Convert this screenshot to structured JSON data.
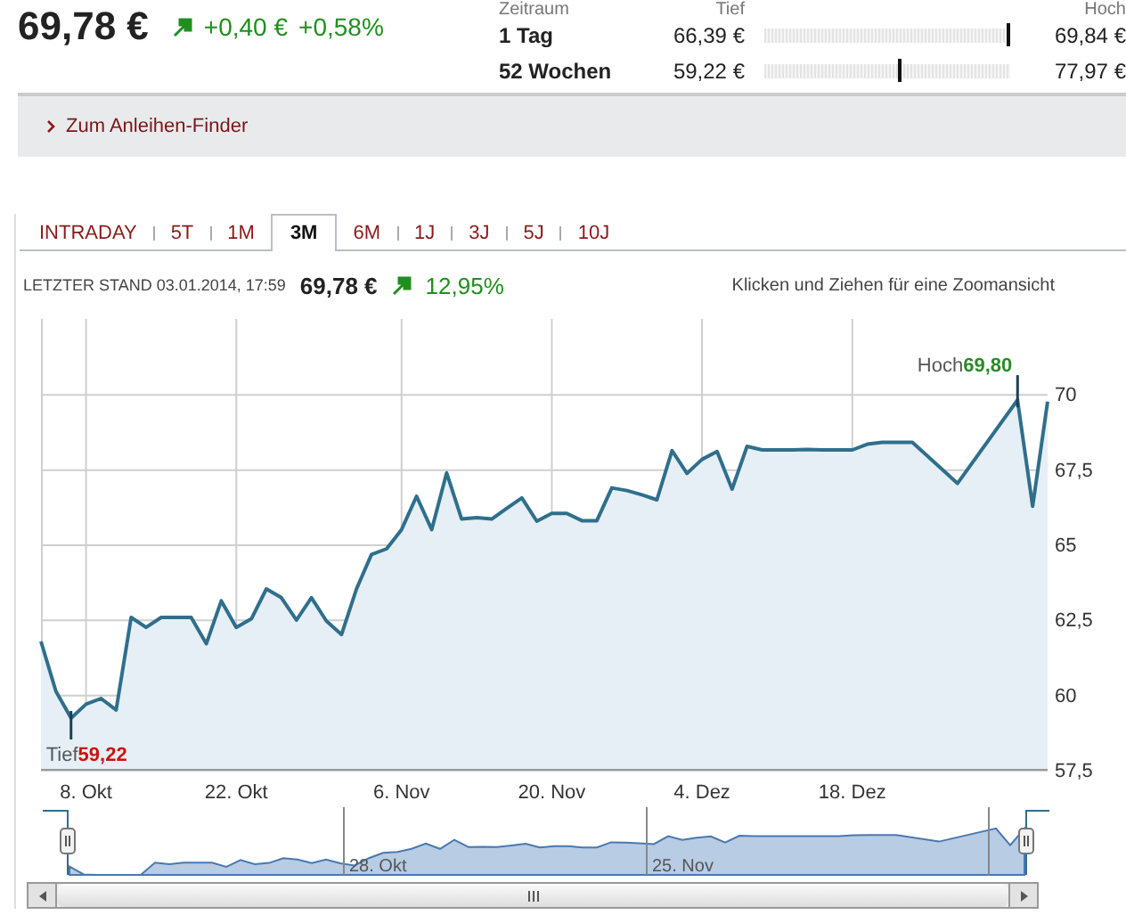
{
  "quote": {
    "price": "69,78 €",
    "change": "+0,40 €",
    "change_pct": "+0,58%"
  },
  "range_table": {
    "columns": {
      "period": "Zeitraum",
      "low": "Tief",
      "high": "Hoch"
    },
    "rows": [
      {
        "period": "1 Tag",
        "low": "66,39 €",
        "level": 0.99,
        "high": "69,84 €"
      },
      {
        "period": "52 Wochen",
        "low": "59,22 €",
        "level": 0.55,
        "high": "77,97 €"
      }
    ]
  },
  "finder_link": "Zum Anleihen-Finder",
  "tabs": [
    {
      "label": "INTRADAY",
      "selected": false
    },
    {
      "label": "5T",
      "selected": false
    },
    {
      "label": "1M",
      "selected": false
    },
    {
      "label": "3M",
      "selected": true
    },
    {
      "label": "6M",
      "selected": false
    },
    {
      "label": "1J",
      "selected": false
    },
    {
      "label": "3J",
      "selected": false
    },
    {
      "label": "5J",
      "selected": false
    },
    {
      "label": "10J",
      "selected": false
    }
  ],
  "last_quote": {
    "label": "LETZTER STAND 03.01.2014, 17:59",
    "price": "69,78 €",
    "change_pct": "12,95%"
  },
  "zoom_hint": "Klicken und Ziehen für eine Zoomansicht",
  "chart": {
    "chart_data": {
      "type": "area",
      "grid": true,
      "ylim": [
        57.5,
        72.5
      ],
      "categories": [
        null,
        null,
        null,
        "8. Okt",
        null,
        null,
        null,
        null,
        null,
        null,
        null,
        null,
        null,
        "22. Okt",
        null,
        null,
        null,
        null,
        null,
        null,
        null,
        null,
        null,
        null,
        "6. Nov",
        null,
        null,
        null,
        null,
        null,
        null,
        null,
        null,
        null,
        "20. Nov",
        null,
        null,
        null,
        null,
        null,
        null,
        null,
        null,
        null,
        "4. Dez",
        null,
        null,
        null,
        null,
        null,
        null,
        null,
        null,
        null,
        "18. Dez",
        null,
        null,
        null,
        null,
        null,
        null,
        null,
        null,
        null,
        null,
        null,
        null,
        null
      ],
      "series": [
        {
          "color": "#2f6f8c",
          "values": [
            61.77,
            60.11,
            59.22,
            59.68,
            59.87,
            59.49,
            62.57,
            62.24,
            62.57,
            62.57,
            62.57,
            61.69,
            63.12,
            62.24,
            62.52,
            63.52,
            63.23,
            62.48,
            63.23,
            62.45,
            62.0,
            63.52,
            64.66,
            64.85,
            65.49,
            66.6,
            65.49,
            67.38,
            65.84,
            65.89,
            65.84,
            66.2,
            66.55,
            65.77,
            66.03,
            66.03,
            65.79,
            65.79,
            66.88,
            66.79,
            66.65,
            66.48,
            68.12,
            67.36,
            67.83,
            68.09,
            66.84,
            68.26,
            68.14,
            68.14,
            68.14,
            68.16,
            68.14,
            68.14,
            68.14,
            68.33,
            68.4,
            68.4,
            68.4,
            null,
            null,
            67.03,
            null,
            null,
            null,
            69.8,
            66.27,
            69.75
          ]
        }
      ],
      "yticks": [
        {
          "value": 57.5,
          "label": "57,5"
        },
        {
          "value": 60,
          "label": "60"
        },
        {
          "value": 62.5,
          "label": "62,5"
        },
        {
          "value": 65,
          "label": "65"
        },
        {
          "value": 67.5,
          "label": "67,5"
        },
        {
          "value": 70,
          "label": "70"
        }
      ]
    },
    "markers": [
      {
        "kind": "low",
        "label": "Tief",
        "value": "59,22"
      },
      {
        "kind": "high",
        "label": "Hoch",
        "value": "69,80"
      }
    ]
  },
  "navigator": {
    "labels": [
      "28. Okt",
      "25. Nov"
    ]
  }
}
